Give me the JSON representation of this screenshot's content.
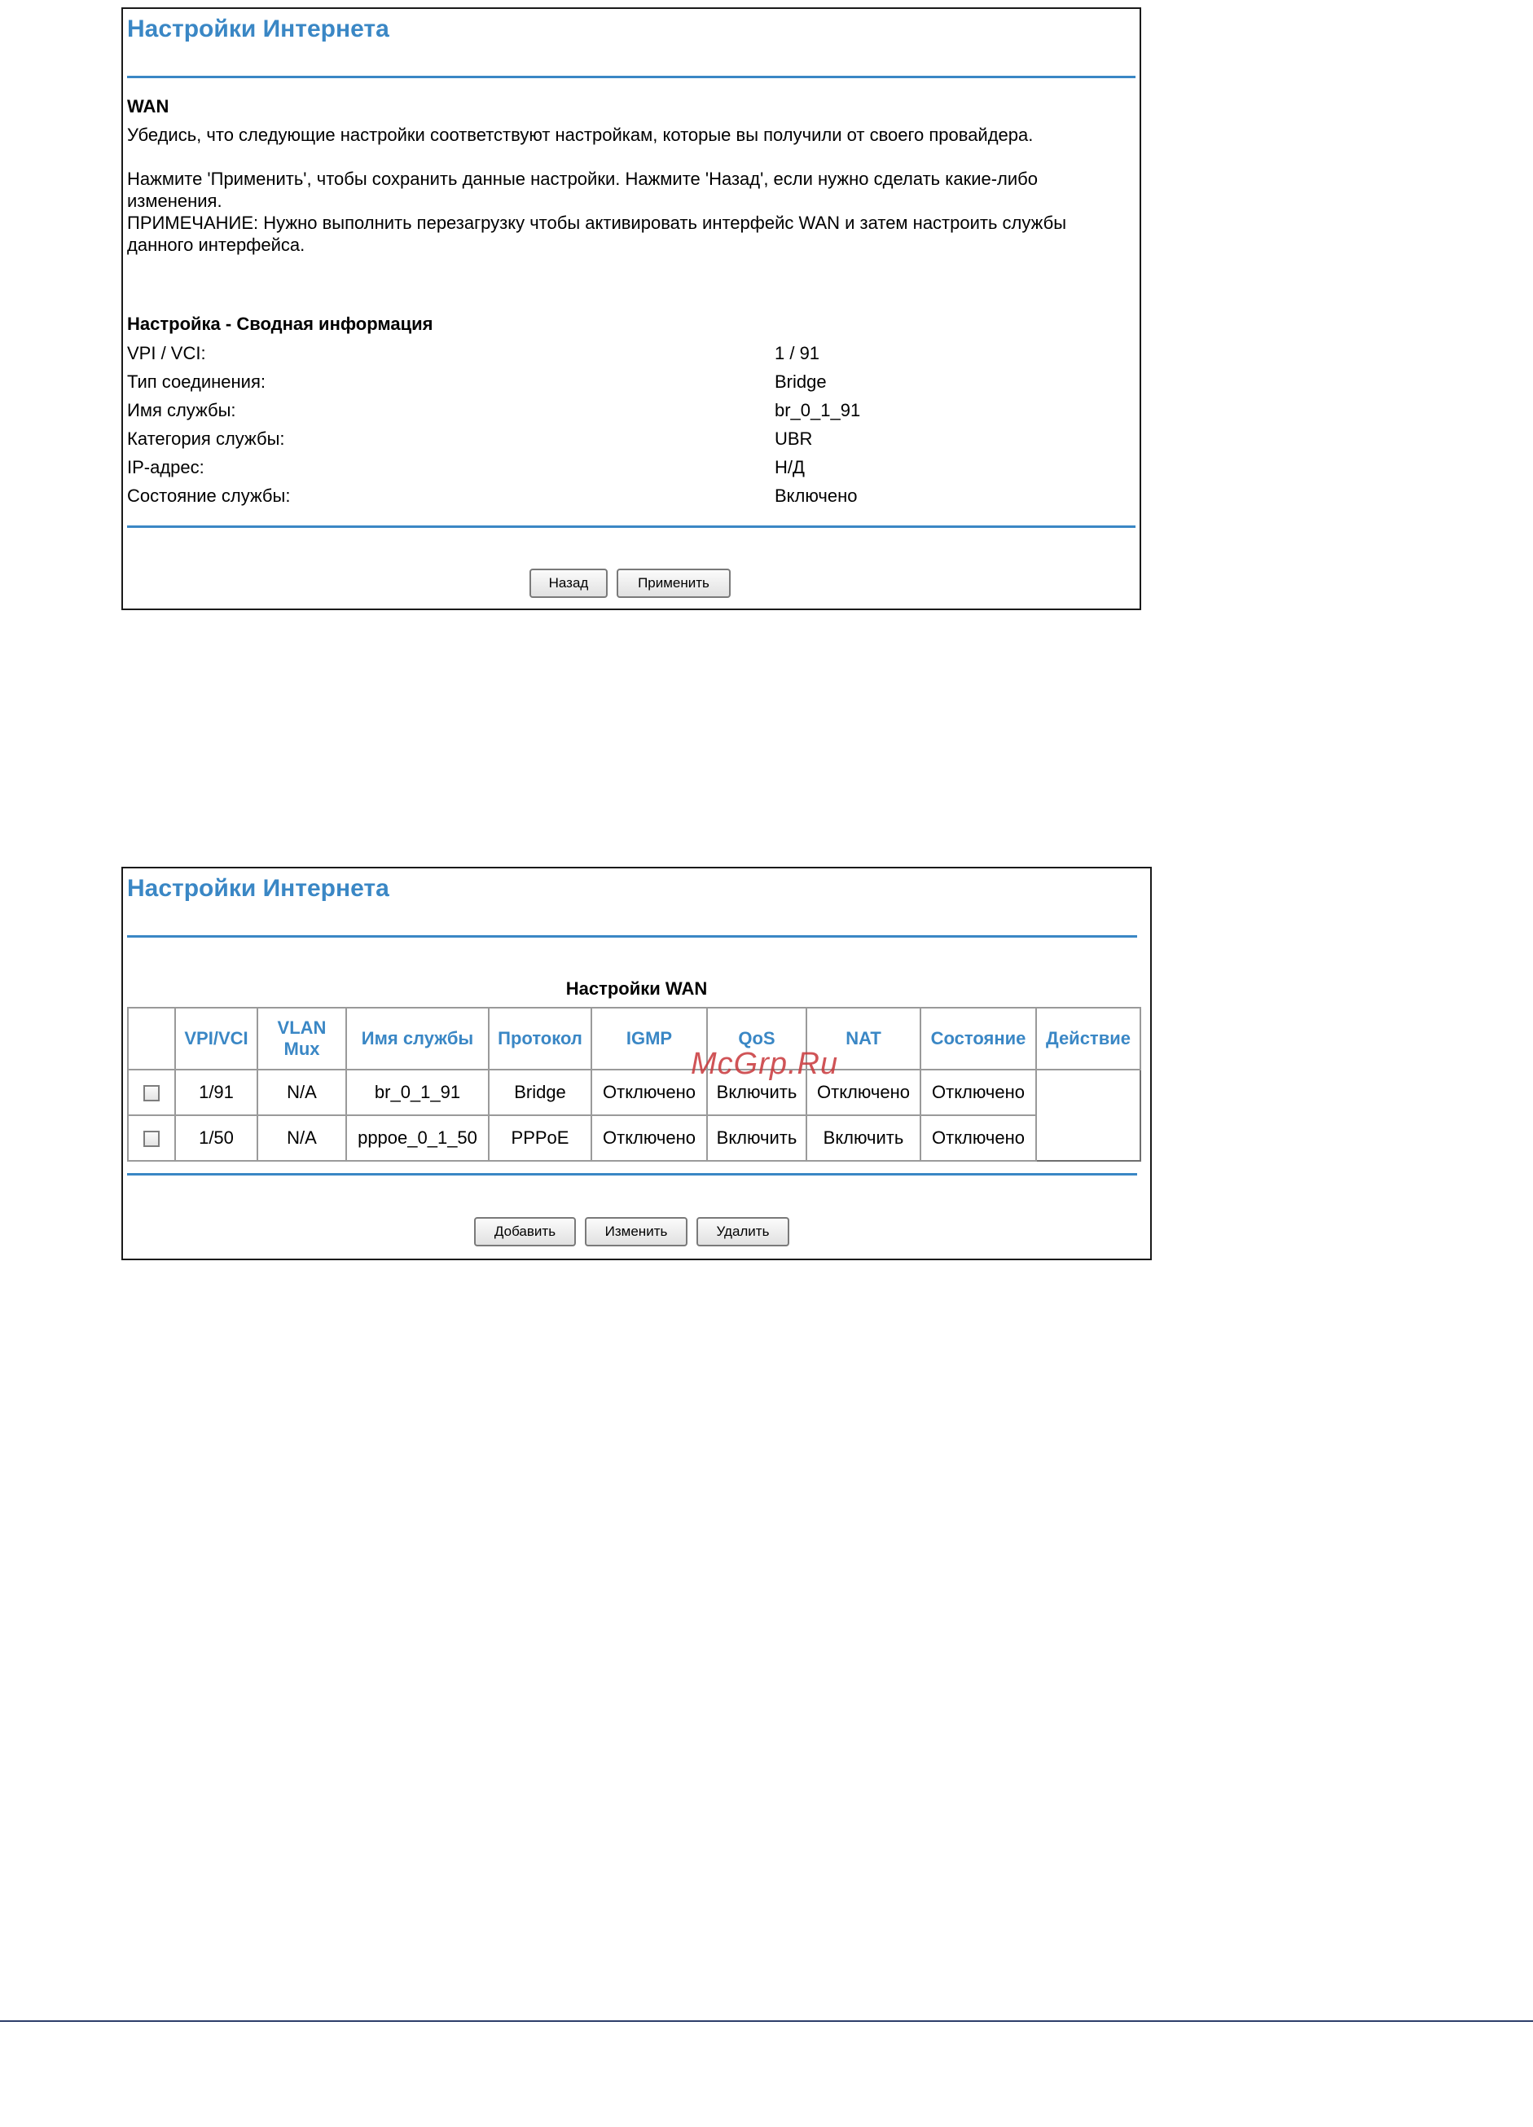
{
  "summary_screen": {
    "title": "Настройки Интернета",
    "section_heading": "WAN",
    "intro_text": "Убедись, что следующие настройки соответствуют настройкам, которые вы получили от своего провайдера.",
    "note_line_1": "Нажмите 'Применить', чтобы сохранить данные настройки. Нажмите 'Назад', если нужно сделать какие-либо",
    "note_line_2": "изменения.",
    "note_line_3": "ПРИМЕЧАНИЕ: Нужно выполнить перезагрузку чтобы активировать интерфейс WAN и затем настроить службы",
    "note_line_4": "данного интерфейса.",
    "summary_heading": "Настройка - Сводная информация",
    "rows": [
      {
        "label": "VPI / VCI:",
        "value": "1 / 91"
      },
      {
        "label": "Тип соединения:",
        "value": "Bridge"
      },
      {
        "label": "Имя службы:",
        "value": "br_0_1_91"
      },
      {
        "label": "Категория службы:",
        "value": "UBR"
      },
      {
        "label": "IP-адрес:",
        "value": "Н/Д"
      },
      {
        "label": "Состояние службы:",
        "value": "Включено"
      }
    ],
    "back_label": "Назад",
    "apply_label": "Применить"
  },
  "wan_screen": {
    "title": "Настройки Интернета",
    "table_title": "Настройки WAN",
    "columns": {
      "vpi_vci": "VPI/VCI",
      "vlan_mux_1": "VLAN",
      "vlan_mux_2": "Mux",
      "service_name": "Имя службы",
      "protocol": "Протокол",
      "igmp": "IGMP",
      "qos": "QoS",
      "nat": "NAT",
      "state": "Состояние",
      "action": "Действие"
    },
    "rows": [
      {
        "vpi_vci": "1/91",
        "vlan_mux": "N/A",
        "service_name": "br_0_1_91",
        "protocol": "Bridge",
        "igmp": "Отключено",
        "qos": "Включить",
        "nat": "Отключено",
        "state": "Отключено"
      },
      {
        "vpi_vci": "1/50",
        "vlan_mux": "N/A",
        "service_name": "pppoe_0_1_50",
        "protocol": "PPPoE",
        "igmp": "Отключено",
        "qos": "Включить",
        "nat": "Включить",
        "state": "Отключено"
      }
    ],
    "add_label": "Добавить",
    "edit_label": "Изменить",
    "delete_label": "Удалить"
  },
  "watermark_text": "McGrp.Ru",
  "colors": {
    "accent": "#3a87c5",
    "watermark": "#c8373a",
    "footer_line": "#2e3f6b"
  }
}
